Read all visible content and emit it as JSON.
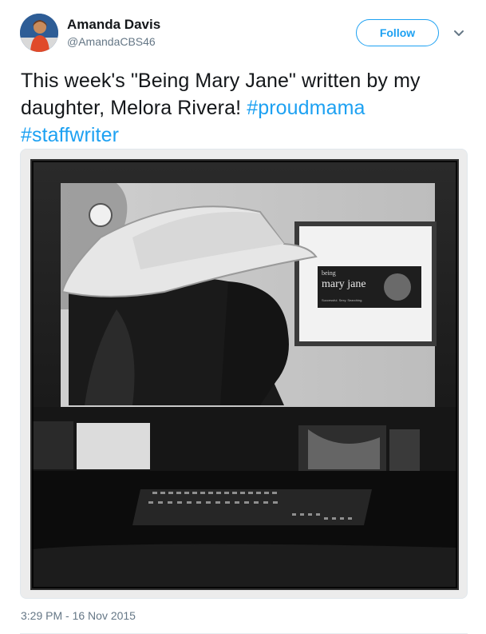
{
  "author": {
    "name": "Amanda Davis",
    "handle": "@AmandaCBS46"
  },
  "actions": {
    "follow_label": "Follow",
    "more_icon": "chevron-down-icon"
  },
  "tweet": {
    "text": "This week's \"Being Mary Jane\" written by my daughter, Melora Rivera!",
    "hashtags": [
      "#proudmama",
      "#staffwriter"
    ]
  },
  "media": {
    "poster_title": "mary jane",
    "poster_title_prefix": "being",
    "poster_tagline": "Successful. Sexy. Searching."
  },
  "meta": {
    "timestamp": "3:29 PM - 16 Nov 2015"
  },
  "colors": {
    "accent": "#1da1f2",
    "secondary_text": "#657786"
  }
}
